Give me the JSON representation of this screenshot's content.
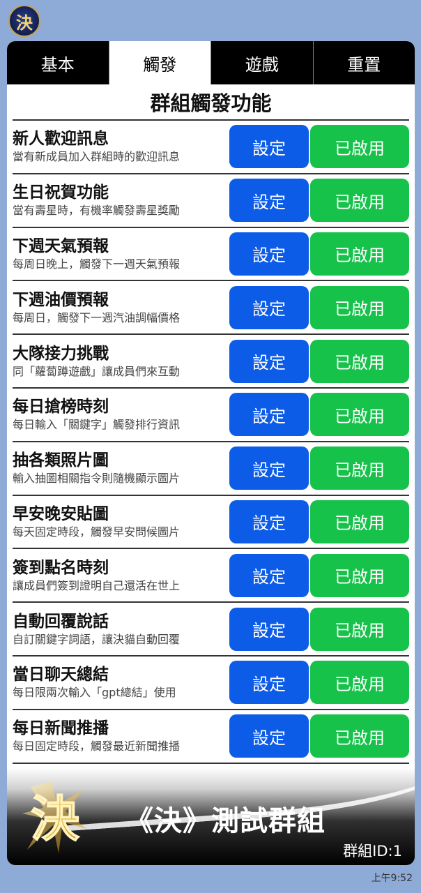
{
  "avatar_text": "決",
  "tabs": [
    {
      "label": "基本"
    },
    {
      "label": "觸發"
    },
    {
      "label": "遊戲"
    },
    {
      "label": "重置"
    }
  ],
  "section_title": "群組觸發功能",
  "rows": [
    {
      "title": "新人歡迎訊息",
      "desc": "當有新成員加入群組時的歡迎訊息",
      "set": "設定",
      "status": "已啟用"
    },
    {
      "title": "生日祝賀功能",
      "desc": "當有壽星時，有機率觸發壽星獎勵",
      "set": "設定",
      "status": "已啟用"
    },
    {
      "title": "下週天氣預報",
      "desc": "每周日晚上，觸發下一週天氣預報",
      "set": "設定",
      "status": "已啟用"
    },
    {
      "title": "下週油價預報",
      "desc": "每周日，觸發下一週汽油調幅價格",
      "set": "設定",
      "status": "已啟用"
    },
    {
      "title": "大隊接力挑戰",
      "desc": "同「蘿蔔蹲遊戲」讓成員們來互動",
      "set": "設定",
      "status": "已啟用"
    },
    {
      "title": "每日搶榜時刻",
      "desc": "每日輸入「關鍵字」觸發排行資訊",
      "set": "設定",
      "status": "已啟用"
    },
    {
      "title": "抽各類照片圖",
      "desc": "輸入抽圖相關指令則隨機顯示圖片",
      "set": "設定",
      "status": "已啟用"
    },
    {
      "title": "早安晚安貼圖",
      "desc": "每天固定時段，觸發早安問候圖片",
      "set": "設定",
      "status": "已啟用"
    },
    {
      "title": "簽到點名時刻",
      "desc": "讓成員們簽到證明自己還活在世上",
      "set": "設定",
      "status": "已啟用"
    },
    {
      "title": "自動回覆說話",
      "desc": "自訂關鍵字詞語，讓決貓自動回覆",
      "set": "設定",
      "status": "已啟用"
    },
    {
      "title": "當日聊天總結",
      "desc": "每日限兩次輸入「gpt總結」使用",
      "set": "設定",
      "status": "已啟用"
    },
    {
      "title": "每日新聞推播",
      "desc": "每日固定時段，觸發最近新聞推播",
      "set": "設定",
      "status": "已啟用"
    }
  ],
  "banner": {
    "logo_text": "決",
    "title": "《決》測試群組",
    "group_id": "群組ID:1"
  },
  "time": "上午9:52",
  "colors": {
    "set_button": "#0d5ce8",
    "enabled_button": "#16c24a",
    "background": "#8eaad6"
  }
}
